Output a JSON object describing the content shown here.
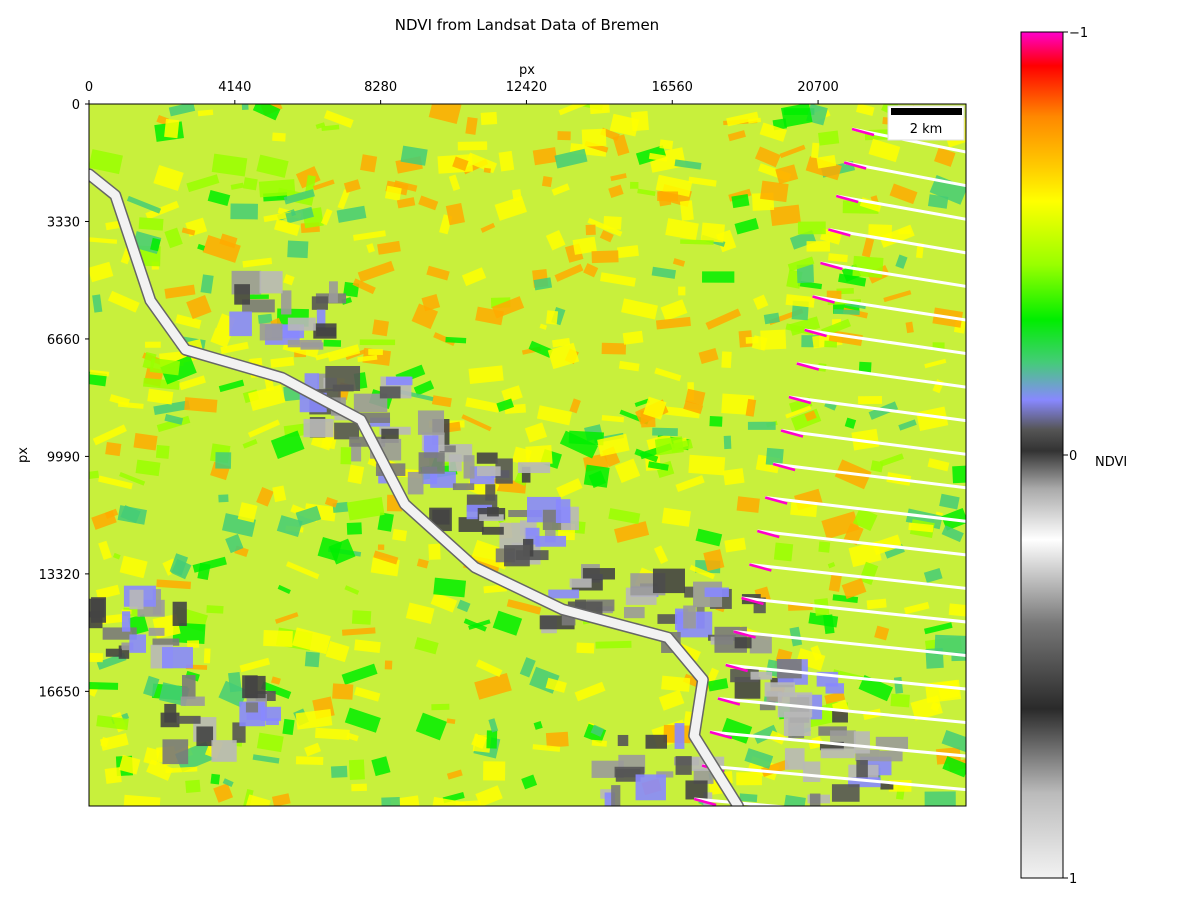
{
  "chart_data": {
    "type": "heatmap",
    "title": "NDVI from Landsat Data of Bremen",
    "xlabel": "px",
    "ylabel": "px",
    "x_ticks": [
      "0",
      "4140",
      "8280",
      "12420",
      "16560",
      "20700"
    ],
    "x_tick_values": [
      0,
      4140,
      8280,
      12420,
      16560,
      20700
    ],
    "xlim": [
      0,
      24900
    ],
    "x_axis_position": "top",
    "y_ticks": [
      "0",
      "3330",
      "6660",
      "9990",
      "13320",
      "16650"
    ],
    "y_tick_values": [
      0,
      3330,
      6660,
      9990,
      13320,
      16650
    ],
    "ylim": [
      19900,
      0
    ],
    "grid": false,
    "scale_bar": {
      "label": "2 km",
      "position": "top-right"
    },
    "colorbar": {
      "label": "NDVI",
      "orientation": "vertical",
      "position": "right",
      "tick_labels": [
        "−1",
        "0",
        "1"
      ],
      "tick_values": [
        -1,
        0,
        1
      ],
      "colormap_stops": [
        {
          "value": -1.0,
          "color": "#ff00cc"
        },
        {
          "value": -0.92,
          "color": "#ff0000"
        },
        {
          "value": -0.8,
          "color": "#ff8800"
        },
        {
          "value": -0.68,
          "color": "#ffcc00"
        },
        {
          "value": -0.6,
          "color": "#ffff00"
        },
        {
          "value": -0.45,
          "color": "#99ff00"
        },
        {
          "value": -0.32,
          "color": "#00ee00"
        },
        {
          "value": -0.22,
          "color": "#44cc77"
        },
        {
          "value": -0.13,
          "color": "#8888ff"
        },
        {
          "value": -0.06,
          "color": "#555555"
        },
        {
          "value": -0.01,
          "color": "#333333"
        },
        {
          "value": 0.08,
          "color": "#aaaaaa"
        },
        {
          "value": 0.2,
          "color": "#ffffff"
        },
        {
          "value": 0.4,
          "color": "#777777"
        },
        {
          "value": 0.6,
          "color": "#2a2a2a"
        },
        {
          "value": 0.8,
          "color": "#bbbbbb"
        },
        {
          "value": 1.0,
          "color": "#f2f2f2"
        }
      ]
    },
    "river_path_fraction": [
      [
        0,
        0.1
      ],
      [
        0.03,
        0.13
      ],
      [
        0.07,
        0.28
      ],
      [
        0.11,
        0.35
      ],
      [
        0.22,
        0.39
      ],
      [
        0.31,
        0.45
      ],
      [
        0.36,
        0.57
      ],
      [
        0.44,
        0.66
      ],
      [
        0.54,
        0.72
      ],
      [
        0.66,
        0.76
      ],
      [
        0.7,
        0.82
      ],
      [
        0.69,
        0.9
      ],
      [
        0.74,
        1
      ]
    ]
  },
  "colors": {
    "vegetation_high": "#ffaa00",
    "vegetation_mid": "#ffff00",
    "vegetation_low": "#00ee00",
    "urban": "#8a8a8a",
    "water": "#f2f2f2",
    "stripe_artifact": "#ff00cc"
  }
}
